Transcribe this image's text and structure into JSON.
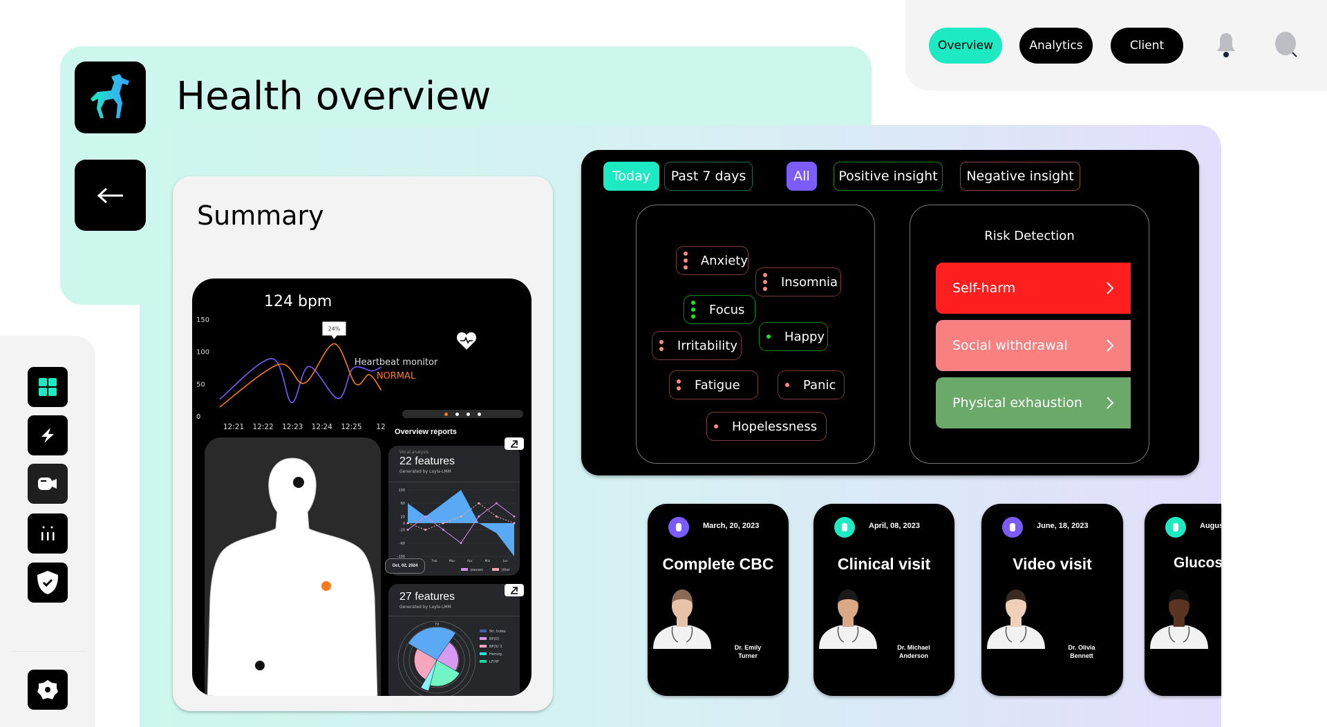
{
  "header": {
    "title": "Health overview"
  },
  "nav": {
    "items": [
      {
        "label": "Overview",
        "active": true
      },
      {
        "label": "Analytics"
      },
      {
        "label": "Client"
      }
    ],
    "bell_icon": "bell-icon",
    "search_icon": "search-icon"
  },
  "colors": {
    "accent": "#1de9c2",
    "purple": "#7b5cff",
    "orange": "#ff7a1a",
    "red": "#ff1f1f",
    "salmon": "#f88080",
    "green": "#6aa96a"
  },
  "sidebar": {
    "items": [
      "dashboard-icon",
      "bolt-icon",
      "video-icon",
      "bars-icon",
      "shield-check-icon"
    ],
    "bottom": "settings-icon"
  },
  "summary": {
    "title": "Summary",
    "heart": {
      "value": "124 bpm",
      "monitor_label": "Heartbeat monitor",
      "status": "NORMAL",
      "tooltip": "24%"
    },
    "overview_reports": "Overview reports",
    "report1": {
      "kicker": "Vocal analysis",
      "title": "22 features",
      "sub": "Generated by Layla-LMM",
      "date": "Oct, 02, 2024"
    },
    "report2": {
      "title": "27 features",
      "sub": "Generated by Layla-LMM"
    }
  },
  "chart_data": [
    {
      "type": "line",
      "ylim": [
        0,
        150
      ],
      "yticks": [
        "150",
        "100",
        "50",
        "0"
      ],
      "xticks": [
        "12:21",
        "12:22",
        "12:23",
        "12:24",
        "12:25",
        "12"
      ],
      "series": [
        {
          "color": "#7b5cff",
          "x": [
            "12:20:32",
            "12:22:17",
            "12:22:57",
            "12:23:32",
            "12:24:31",
            "12:25:01",
            "12:25:39",
            "12:25:58"
          ],
          "values": [
            26,
            89,
            21,
            77,
            27,
            74,
            70,
            76
          ]
        },
        {
          "color": "#ff7a1a",
          "x": [
            "12:20:32",
            "12:22:31",
            "12:23:23",
            "12:24:23",
            "12:25:06",
            "12:25:34",
            "12:25:58"
          ],
          "values": [
            14,
            80,
            51,
            112,
            50,
            64,
            40
          ]
        }
      ]
    },
    {
      "type": "area",
      "ylim": [
        -100,
        100
      ],
      "yticks": [
        "100",
        "60",
        "20",
        "0",
        "-20",
        "-60",
        "-100"
      ],
      "xticks": [
        "Jan",
        "Feb",
        "Mar",
        "Apr",
        "Mai",
        "Jun"
      ],
      "area": [
        60,
        20,
        60,
        100,
        0,
        -30,
        -100
      ],
      "series": [
        {
          "name": "pauses",
          "color": "#d38cf0",
          "values": [
            -20,
            20,
            -20,
            -60,
            20,
            60,
            20
          ]
        },
        {
          "name": "Jitter",
          "color": "#f7a6b8",
          "values": [
            0,
            -20,
            0,
            20,
            60,
            20,
            0
          ]
        }
      ]
    },
    {
      "type": "polar",
      "rings": [
        "70",
        "60",
        "50",
        "40"
      ],
      "rmax": 70,
      "series": [
        {
          "name": "Str. Index",
          "color": "#3d64a8"
        },
        {
          "name": "BP(D)",
          "color": "#d79af0"
        },
        {
          "name": "BP(S) 3",
          "color": "#f7a6c0"
        },
        {
          "name": "Hemog.",
          "color": "#28e0d6"
        },
        {
          "name": "LF/HF",
          "color": "#1ed9a0"
        }
      ],
      "slices": [
        {
          "color": "#5aa9f5",
          "value": 70
        },
        {
          "color": "#d79af0",
          "value": 46
        },
        {
          "color": "#72f5c4",
          "value": 56
        },
        {
          "color": "#86f2f7",
          "value": 68
        },
        {
          "color": "#f7a6c0",
          "value": 48
        }
      ]
    }
  ],
  "filters": [
    {
      "label": "Today",
      "style": "fill-teal"
    },
    {
      "label": "Past 7 days",
      "style": "outline-teal"
    },
    {
      "label": "All",
      "style": "fill-purple"
    },
    {
      "label": "Positive insight",
      "style": "outline-green"
    },
    {
      "label": "Negative insight",
      "style": "outline-red"
    }
  ],
  "tags": [
    {
      "label": "Anxiety",
      "dots": 3
    },
    {
      "label": "Insomnia",
      "dots": 3
    },
    {
      "label": "Focus",
      "dots": 3,
      "positive": true
    },
    {
      "label": "Happy",
      "dots": 1,
      "positive": true
    },
    {
      "label": "Irritability",
      "dots": 2
    },
    {
      "label": "Fatigue",
      "dots": 2
    },
    {
      "label": "Panic",
      "dots": 1
    },
    {
      "label": "Hopelessness",
      "dots": 1
    }
  ],
  "risk": {
    "title": "Risk Detection",
    "items": [
      {
        "label": "Self-harm",
        "color": "#ff1f1f"
      },
      {
        "label": "Social withdrawal",
        "color": "#f88080"
      },
      {
        "label": "Physical exhaustion",
        "color": "#6aa96a"
      }
    ]
  },
  "visits": [
    {
      "date": "March, 20, 2023",
      "title": "Complete CBC",
      "doctor": "Dr. Emily Turner",
      "icon": "test-tube-icon",
      "icon_color": "#7b5cff"
    },
    {
      "date": "April, 08, 2023",
      "title": "Clinical visit",
      "doctor": "Dr. Michael Anderson",
      "icon": "clipboard-icon",
      "icon_color": "#1de9c2"
    },
    {
      "date": "June, 18, 2023",
      "title": "Video visit",
      "doctor": "Dr. Olivia Bennett",
      "icon": "video-icon",
      "icon_color": "#7b5cff"
    },
    {
      "date": "Augus",
      "title": "Glucos",
      "doctor": "",
      "icon": "drop-icon",
      "icon_color": "#1de9c2"
    }
  ]
}
